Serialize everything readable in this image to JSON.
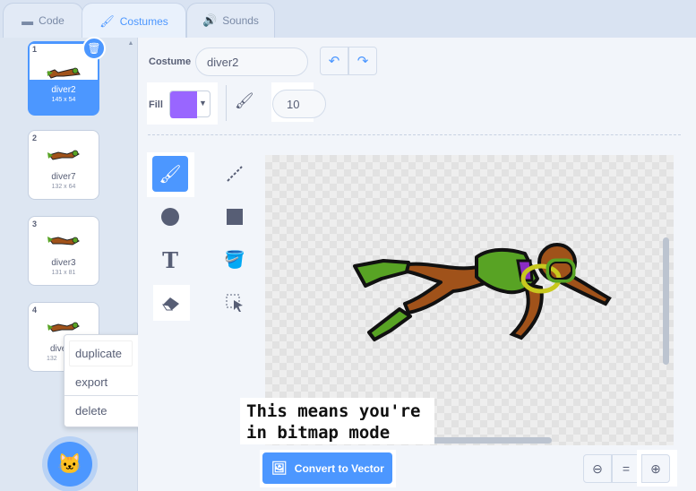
{
  "tabs": [
    {
      "label": "Code",
      "icon": "code-icon"
    },
    {
      "label": "Costumes",
      "icon": "brush-icon"
    },
    {
      "label": "Sounds",
      "icon": "speaker-icon"
    }
  ],
  "costumes": [
    {
      "num": "1",
      "name": "diver2",
      "size": "145 x 54"
    },
    {
      "num": "2",
      "name": "diver7",
      "size": "132 x 64"
    },
    {
      "num": "3",
      "name": "diver3",
      "size": "131 x 81"
    },
    {
      "num": "4",
      "name": "dive",
      "size": "132"
    }
  ],
  "context_menu": {
    "items": [
      "duplicate",
      "export",
      "delete"
    ]
  },
  "editor": {
    "costume_label": "Costume",
    "costume_name": "diver2",
    "fill_label": "Fill",
    "fill_color": "#9966ff",
    "brush_size": "10"
  },
  "annotation": "This means you're\nin bitmap mode",
  "convert_button": "Convert to Vector",
  "zoom": {
    "reset_label": "="
  },
  "colors": {
    "accent": "#4c97ff",
    "skin": "#a0521a",
    "fin": "#58a324"
  }
}
